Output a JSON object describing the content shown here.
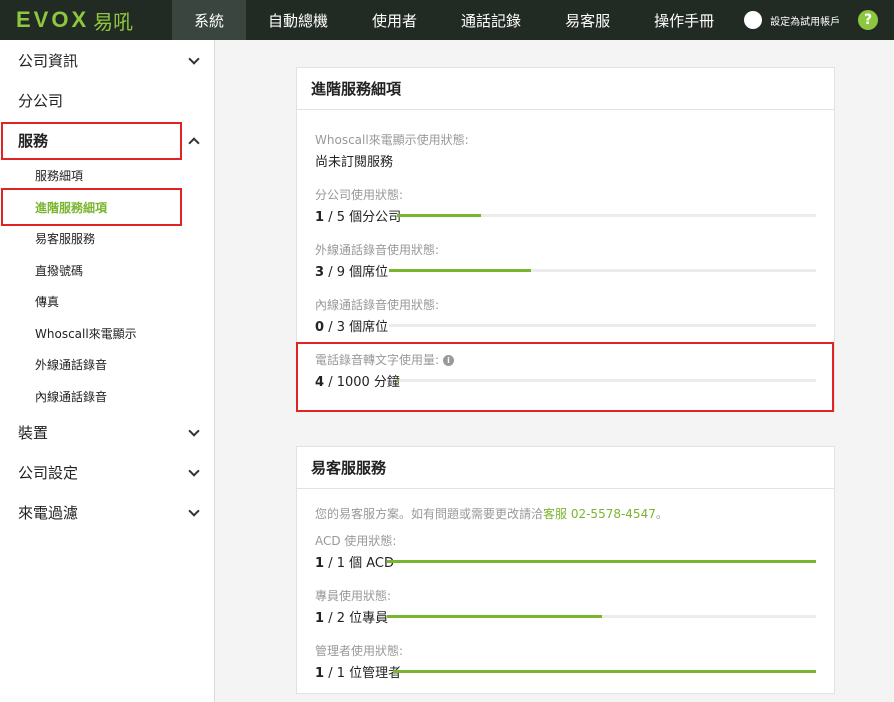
{
  "header": {
    "logo_text": "EVOX",
    "logo_cn": "易吼",
    "nav": [
      "系統",
      "自動總機",
      "使用者",
      "通話記錄",
      "易客服",
      "操作手冊"
    ],
    "trial_label": "設定為試用帳戶",
    "help": "?"
  },
  "sidebar": {
    "items": [
      {
        "label": "公司資訊"
      },
      {
        "label": "分公司"
      },
      {
        "label": "服務"
      },
      {
        "label": "裝置"
      },
      {
        "label": "公司設定"
      },
      {
        "label": "來電過濾"
      }
    ],
    "sub_items": [
      "服務細項",
      "進階服務細項",
      "易客服服務",
      "直撥號碼",
      "傳真",
      "Whoscall來電顯示",
      "外線通話錄音",
      "內線通話錄音"
    ]
  },
  "advanced": {
    "title": "進階服務細項",
    "whoscall_label": "Whoscall來電顯示使用狀態:",
    "whoscall_value": "尚未訂閱服務",
    "stats": [
      {
        "label": "分公司使用狀態:",
        "used": "1",
        "rest": "/ 5 個分公司",
        "fraction": 0.2
      },
      {
        "label": "外線通話錄音使用狀態:",
        "used": "3",
        "rest": "/ 9 個席位",
        "fraction": 0.333
      },
      {
        "label": "內線通話錄音使用狀態:",
        "used": "0",
        "rest": "/ 3 個席位",
        "fraction": 0
      },
      {
        "label": "電話錄音轉文字使用量:",
        "used": "4",
        "rest": "/ 1000 分鐘",
        "fraction": 0.004
      }
    ]
  },
  "cs": {
    "title": "易客服服務",
    "desc_prefix": "您的易客服方案。如有問題或需要更改請洽",
    "desc_link": "客服 02-5578-4547",
    "desc_suffix": "。",
    "stats": [
      {
        "label": "ACD 使用狀態:",
        "used": "1",
        "rest": "/ 1 個 ACD",
        "fraction": 1
      },
      {
        "label": "專員使用狀態:",
        "used": "1",
        "rest": "/ 2 位專員",
        "fraction": 0.5
      },
      {
        "label": "管理者使用狀態:",
        "used": "1",
        "rest": "/ 1 位管理者",
        "fraction": 1
      }
    ]
  },
  "colors": {
    "accent": "#7ab52f",
    "nav_bg": "#222a24",
    "highlight_border": "#e02424"
  }
}
